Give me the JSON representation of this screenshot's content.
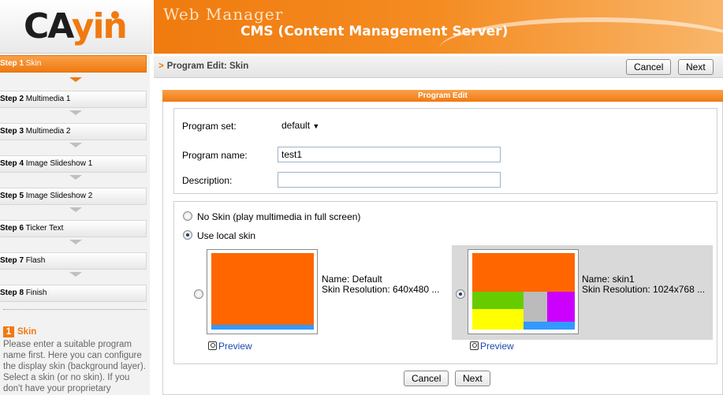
{
  "header": {
    "logo_text_a": "CA",
    "logo_text_b": "yin",
    "title_small": "Web Manager",
    "title_large": "CMS (Content Management Server)"
  },
  "sidebar": {
    "steps": [
      {
        "num": "Step 1",
        "label": "Skin",
        "active": true
      },
      {
        "num": "Step 2",
        "label": "Multimedia 1"
      },
      {
        "num": "Step 3",
        "label": "Multimedia 2"
      },
      {
        "num": "Step 4",
        "label": "Image Slideshow 1"
      },
      {
        "num": "Step 5",
        "label": "Image Slideshow 2"
      },
      {
        "num": "Step 6",
        "label": "Ticker Text"
      },
      {
        "num": "Step 7",
        "label": "Flash"
      },
      {
        "num": "Step 8",
        "label": "Finish"
      }
    ],
    "help": {
      "badge": "1",
      "title": "Skin",
      "text": "Please enter a suitable program name first. Here you can configure the display skin (background layer). Select a skin (or no skin). If you don't have your proprietary"
    }
  },
  "breadcrumb": {
    "arrow": ">",
    "text": "Program Edit: Skin"
  },
  "toolbar": {
    "cancel": "Cancel",
    "next": "Next"
  },
  "panel": {
    "title": "Program Edit",
    "program_set_label": "Program set:",
    "program_set_value": "default",
    "program_name_label": "Program name:",
    "program_name_value": "test1",
    "description_label": "Description:",
    "description_value": "",
    "no_skin_label": "No Skin (play multimedia in full screen)",
    "local_skin_label": "Use local skin",
    "skins": [
      {
        "name": "Name: Default",
        "resolution": "Skin Resolution: 640x480 ...",
        "preview": "Preview",
        "selected": false
      },
      {
        "name": "Name: skin1",
        "resolution": "Skin Resolution: 1024x768 ...",
        "preview": "Preview",
        "selected": true
      }
    ],
    "bottom_cancel": "Cancel",
    "bottom_next": "Next"
  },
  "colors": {
    "accent": "#f07a10",
    "skin_orange": "#ff6600",
    "skin_blue": "#3399ff",
    "skin_green": "#66cc00",
    "skin_gray": "#bbbbbb",
    "skin_purple": "#cc00ff",
    "skin_yellow": "#ffff00"
  }
}
